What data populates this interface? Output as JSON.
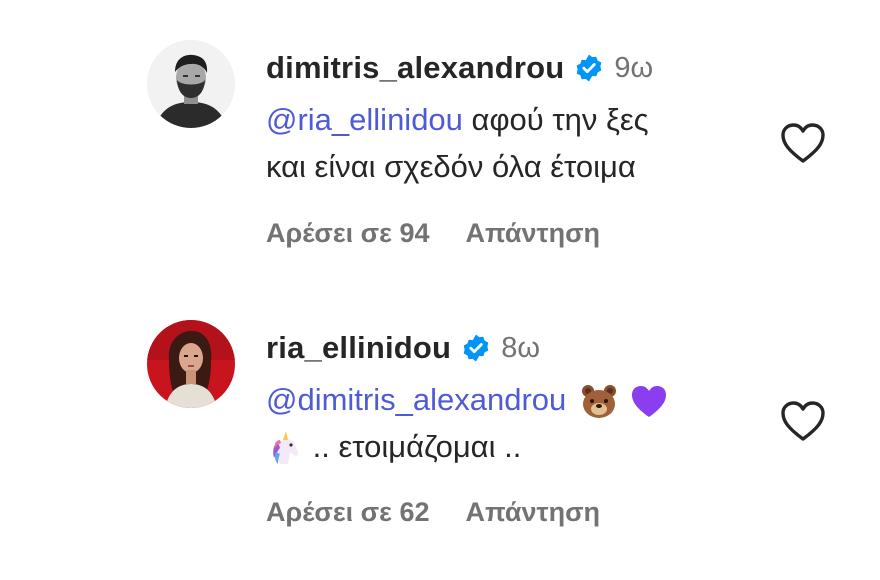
{
  "comments": [
    {
      "username": "dimitris_alexandrou",
      "verified": true,
      "time": "9ω",
      "mention": "@ria_ellinidou",
      "text_line1": " αφού την ξες",
      "text_line2": "και είναι σχεδόν όλα έτοιμα",
      "likes": "Αρέσει σε 94",
      "reply_label": "Απάντηση"
    },
    {
      "username": "ria_ellinidou",
      "verified": true,
      "time": "8ω",
      "mention": "@dimitris_alexandrou",
      "emojis_line1": [
        "bear-face-emoji",
        "purple-heart-emoji"
      ],
      "emoji_line2": "unicorn-emoji",
      "text_line2": " .. ετοιμάζομαι ..",
      "likes": "Αρέσει σε 62",
      "reply_label": "Απάντηση"
    }
  ],
  "colors": {
    "mention": "#4f5bd5",
    "verified_badge": "#0095f6",
    "text": "#262626",
    "muted": "#737373"
  }
}
